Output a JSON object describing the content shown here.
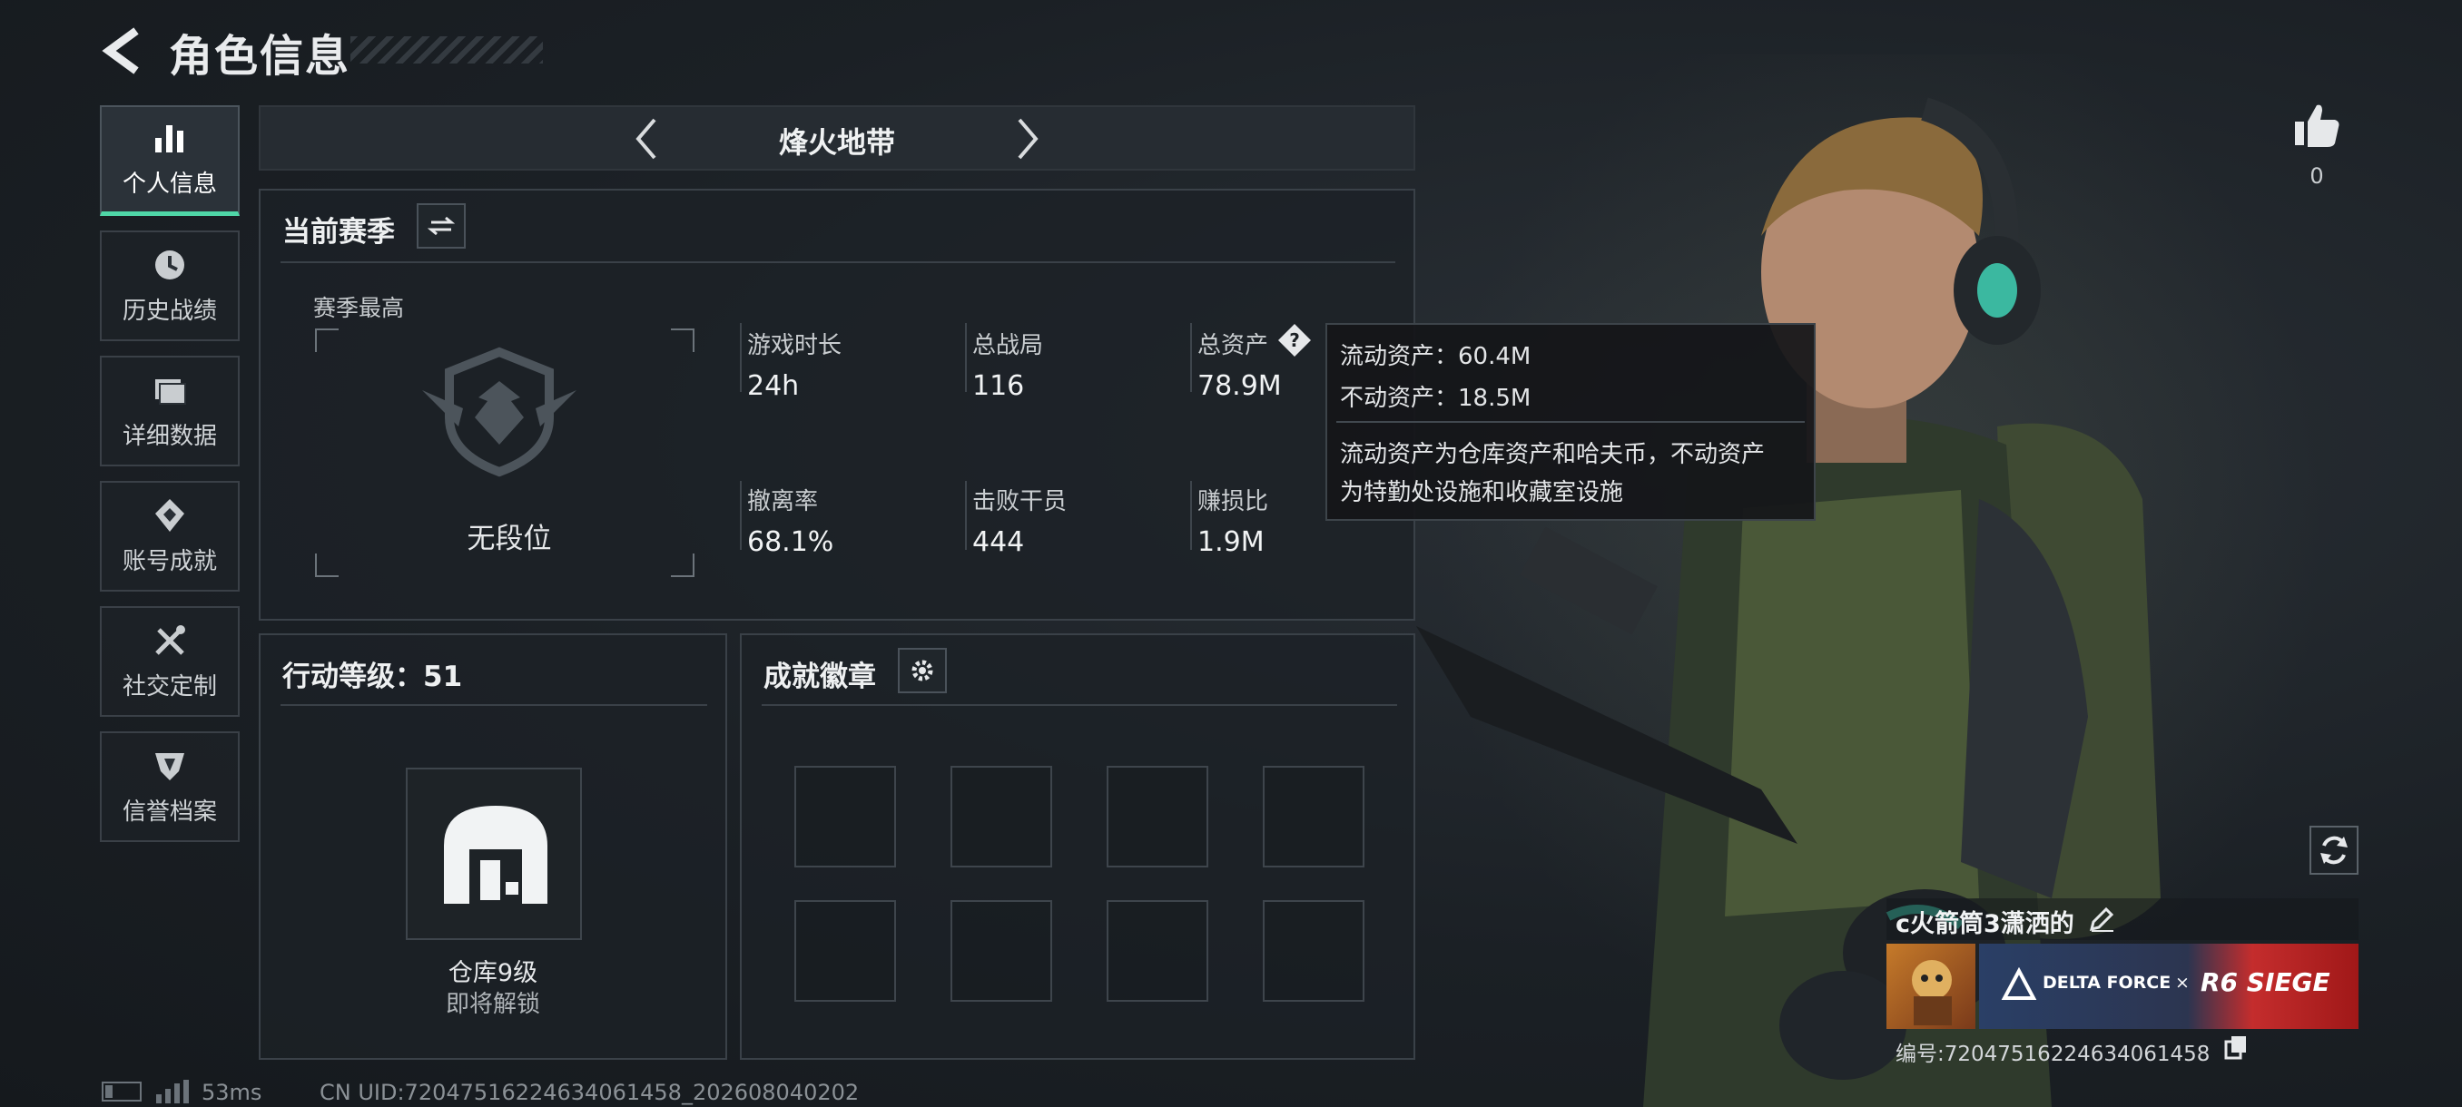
{
  "header": {
    "title": "角色信息"
  },
  "nav": {
    "items": [
      {
        "label": "个人信息",
        "icon": "bar-chart-icon",
        "active": true
      },
      {
        "label": "历史战绩",
        "icon": "history-clock-icon",
        "active": false
      },
      {
        "label": "详细数据",
        "icon": "folder-data-icon",
        "active": false
      },
      {
        "label": "账号成就",
        "icon": "achievement-diamond-icon",
        "active": false
      },
      {
        "label": "社交定制",
        "icon": "tools-icon",
        "active": false
      },
      {
        "label": "信誉档案",
        "icon": "reputation-shield-icon",
        "active": false
      }
    ]
  },
  "mode": {
    "name": "烽火地带"
  },
  "season": {
    "title": "当前赛季",
    "best_label": "赛季最高",
    "rank_text": "无段位",
    "stats": [
      {
        "label": "游戏时长",
        "value": "24h"
      },
      {
        "label": "总战局",
        "value": "116"
      },
      {
        "label": "总资产",
        "value": "78.9M"
      },
      {
        "label": "撤离率",
        "value": "68.1%"
      },
      {
        "label": "击败干员",
        "value": "444"
      },
      {
        "label": "赚损比",
        "value": "1.9M"
      }
    ]
  },
  "tooltip": {
    "liquid": "流动资产：60.4M",
    "fixed": "不动资产：18.5M",
    "note_line1": "流动资产为仓库资产和哈夫币，不动资产",
    "note_line2": "为特勤处设施和收藏室设施"
  },
  "action_level": {
    "title": "行动等级：51",
    "unlock_name": "仓库9级",
    "unlock_status": "即将解锁"
  },
  "badges": {
    "title": "成就徽章",
    "slots": 8
  },
  "like": {
    "count": "0"
  },
  "player": {
    "name": "c火箭筒3潇洒的",
    "banner_brand_left": "DELTA FORCE",
    "banner_x": "×",
    "banner_brand_right": "R6 SIEGE",
    "id_text": "编号:72047516224634061458"
  },
  "footer": {
    "ping": "53ms",
    "uid": "CN UID:72047516224634061458_202608040202"
  },
  "colors": {
    "accent": "#4fd6a7",
    "banner_red": "#d83a3a",
    "banner_blue": "#2a3f66"
  }
}
